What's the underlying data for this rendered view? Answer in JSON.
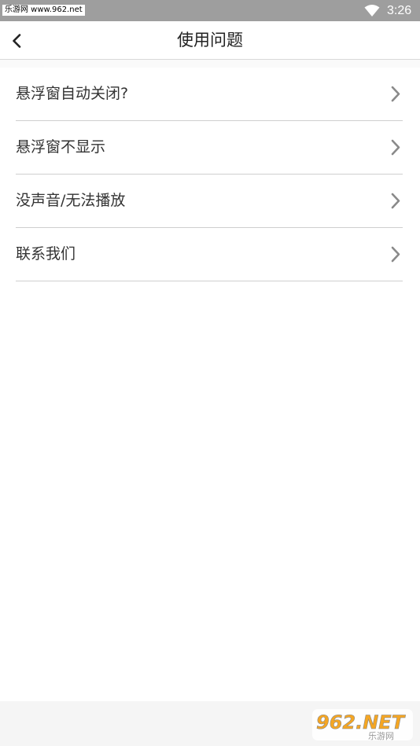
{
  "status_bar": {
    "watermark": "乐游网 www.962.net",
    "time": "3:26"
  },
  "header": {
    "title": "使用问题"
  },
  "faq_items": [
    {
      "label": "悬浮窗自动关闭?"
    },
    {
      "label": "悬浮窗不显示"
    },
    {
      "label": "没声音/无法播放"
    },
    {
      "label": "联系我们"
    }
  ],
  "logo": {
    "text_main": "962.NET",
    "text_sub": "乐游网"
  },
  "colors": {
    "status_bar": "#9e9e9e",
    "chevron": "#8a8a8a",
    "divider": "#cfcfcf",
    "logo_orange": "#f5a623"
  },
  "icons": [
    "back-arrow-icon",
    "wifi-icon",
    "chevron-right-icon"
  ]
}
